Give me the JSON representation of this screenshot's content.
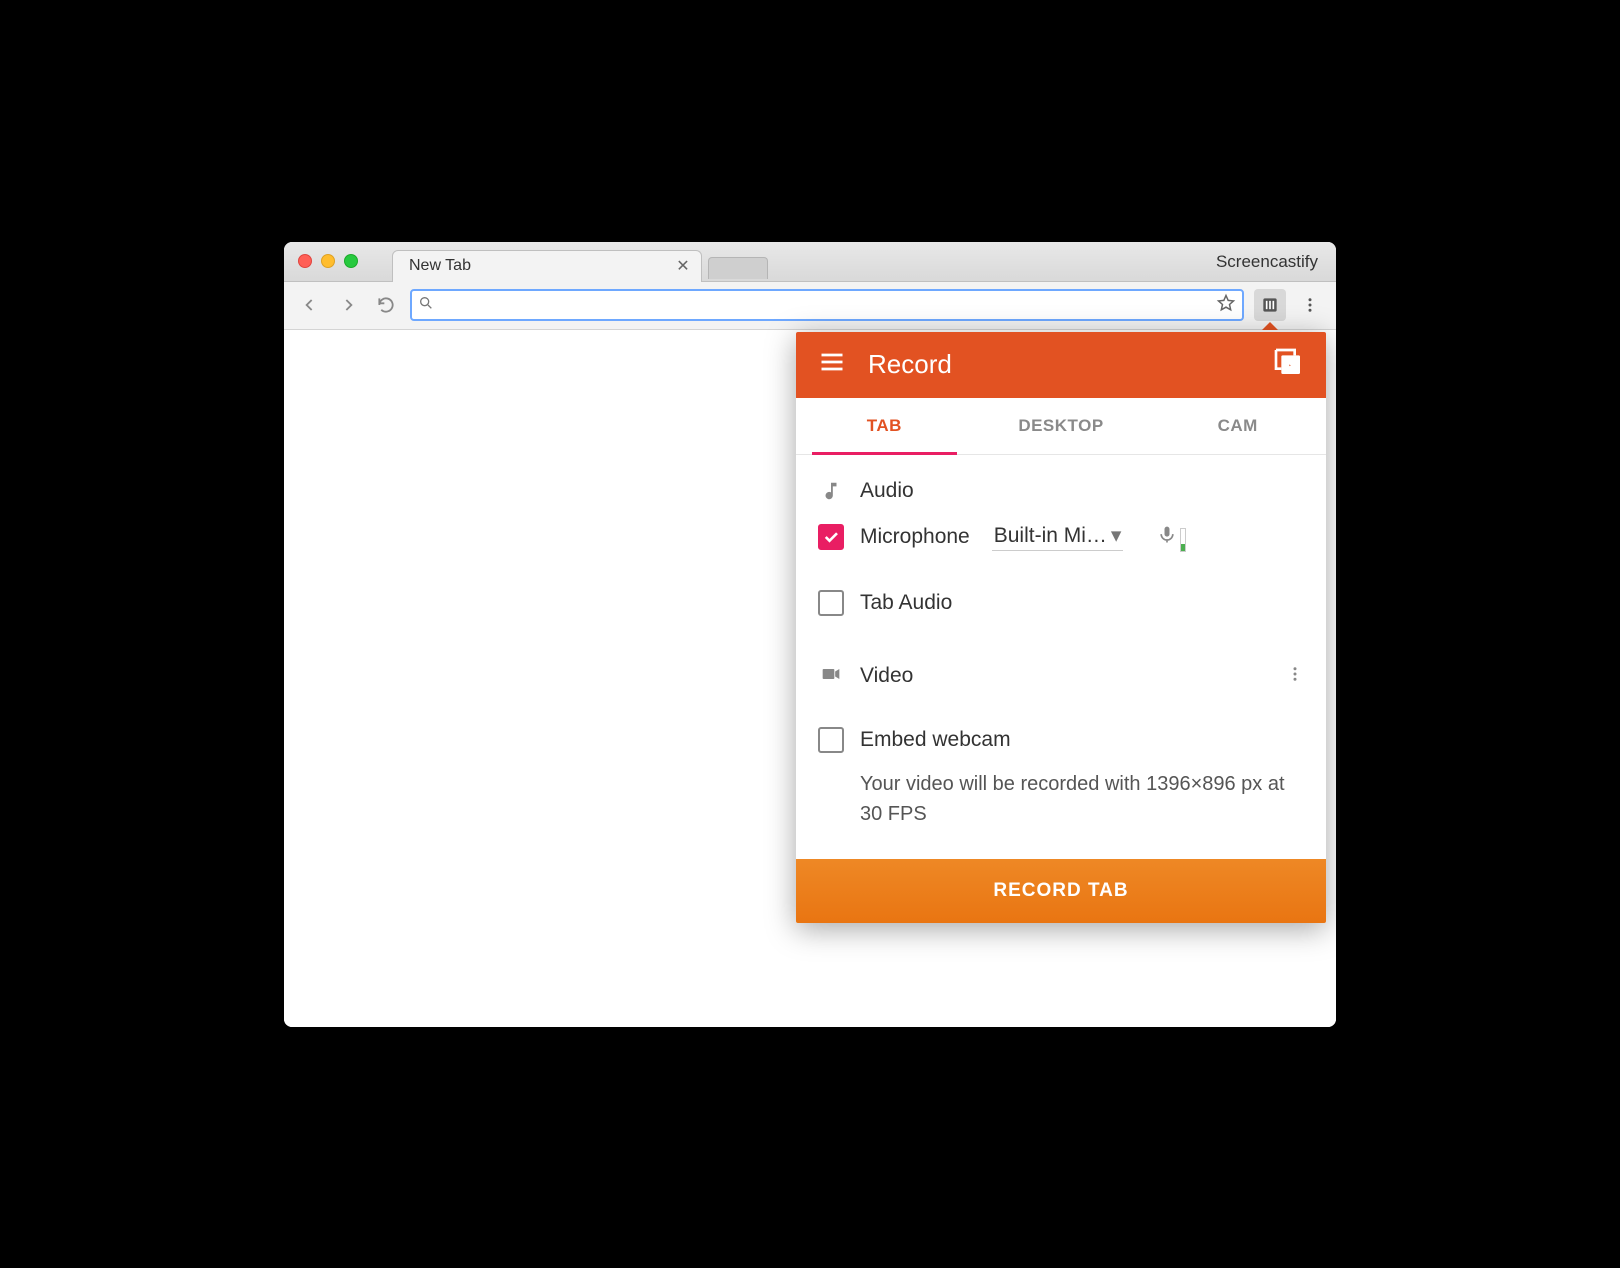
{
  "window": {
    "title": "Screencastify"
  },
  "browser": {
    "tab_title": "New Tab",
    "omnibox_value": ""
  },
  "popup": {
    "header": {
      "title": "Record"
    },
    "tabs": [
      {
        "label": "TAB",
        "active": true
      },
      {
        "label": "DESKTOP",
        "active": false
      },
      {
        "label": "CAM",
        "active": false
      }
    ],
    "audio": {
      "section_label": "Audio",
      "microphone": {
        "label": "Microphone",
        "checked": true,
        "device": "Built-in Mi…"
      },
      "tab_audio": {
        "label": "Tab Audio",
        "checked": false
      }
    },
    "video": {
      "section_label": "Video",
      "embed_webcam": {
        "label": "Embed webcam",
        "checked": false
      },
      "hint": "Your video will be recorded with 1396×896 px at 30 FPS"
    },
    "record_button": "RECORD TAB"
  }
}
